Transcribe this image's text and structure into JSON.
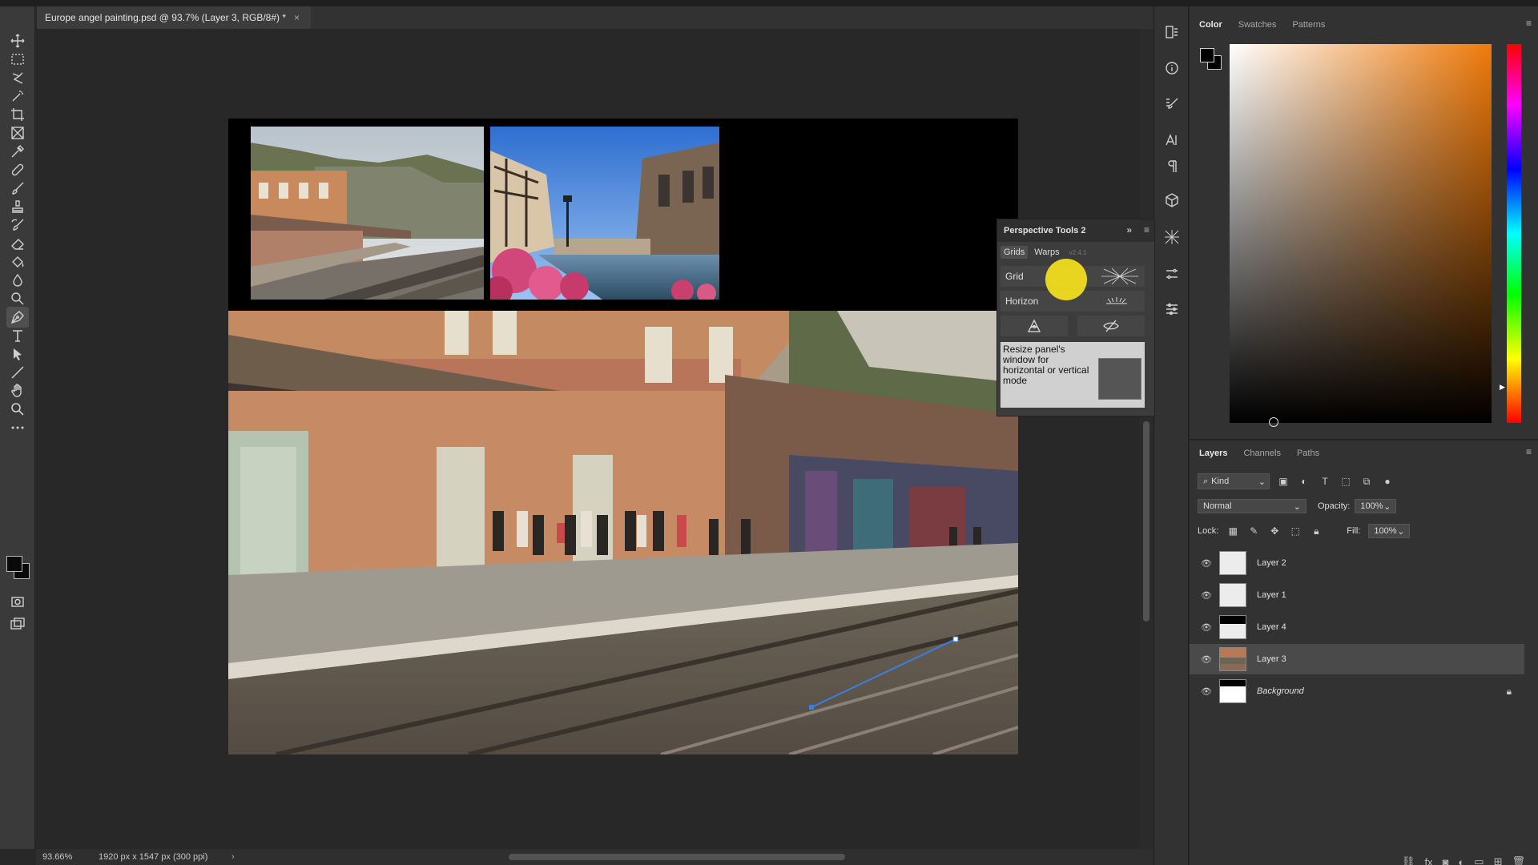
{
  "document": {
    "tab_title": "Europe angel painting.psd @ 93.7% (Layer 3, RGB/8#) *",
    "close_glyph": "×"
  },
  "status": {
    "zoom": "93.66%",
    "doc_info": "1920 px x 1547 px (300 ppi)",
    "arrow": "›"
  },
  "toolbar": {
    "tools": [
      "move-tool",
      "marquee-tool",
      "lasso-tool",
      "magic-wand-tool",
      "crop-tool",
      "frame-tool",
      "eyedropper-tool",
      "healing-brush-tool",
      "brush-tool",
      "clone-stamp-tool",
      "history-brush-tool",
      "eraser-tool",
      "paint-bucket-tool",
      "blur-tool",
      "dodge-tool",
      "pen-tool",
      "type-tool",
      "path-selection-tool",
      "line-tool",
      "hand-tool",
      "zoom-tool",
      "more-tools"
    ],
    "active_tool": "pen-tool"
  },
  "perspective_panel": {
    "title": "Perspective Tools 2",
    "tabs": [
      "Grids",
      "Warps"
    ],
    "active_tab": "Grids",
    "version": "v2.4.1",
    "grid_label": "Grid",
    "horizon_label": "Horizon",
    "note": "Resize panel's window for horizontal or vertical mode",
    "expand_glyph": "»",
    "menu_glyph": "≡"
  },
  "color_panel": {
    "tabs": [
      "Color",
      "Swatches",
      "Patterns"
    ],
    "active_tab": "Color",
    "foreground": "#000000",
    "background": "#000000",
    "hue_color": "#ef7a0a"
  },
  "layers_panel": {
    "tabs": [
      "Layers",
      "Channels",
      "Paths"
    ],
    "active_tab": "Layers",
    "kind_label": "Kind",
    "blend_mode": "Normal",
    "opacity_label": "Opacity:",
    "opacity_value": "100%",
    "lock_label": "Lock:",
    "fill_label": "Fill:",
    "fill_value": "100%",
    "layers": [
      {
        "name": "Layer 2",
        "visible": true,
        "selected": false,
        "locked": false,
        "italic": false
      },
      {
        "name": "Layer 1",
        "visible": true,
        "selected": false,
        "locked": false,
        "italic": false
      },
      {
        "name": "Layer 4",
        "visible": true,
        "selected": false,
        "locked": false,
        "italic": false
      },
      {
        "name": "Layer 3",
        "visible": true,
        "selected": true,
        "locked": false,
        "italic": false
      },
      {
        "name": "Background",
        "visible": true,
        "selected": false,
        "locked": true,
        "italic": true
      }
    ]
  }
}
